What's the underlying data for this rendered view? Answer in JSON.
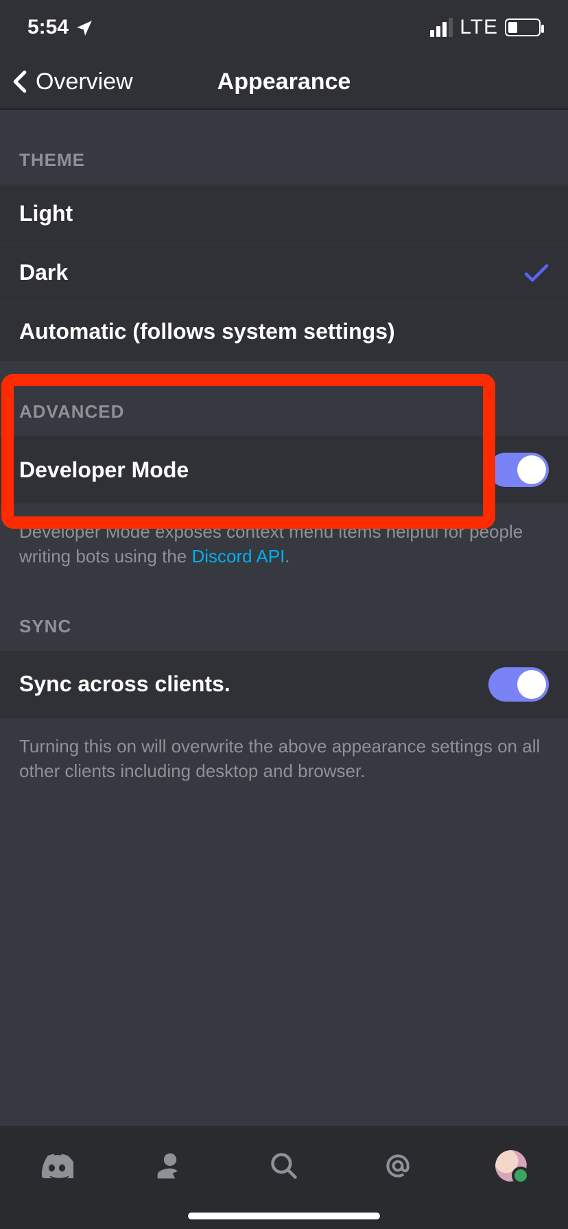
{
  "status": {
    "time": "5:54",
    "network": "LTE"
  },
  "nav": {
    "back": "Overview",
    "title": "Appearance"
  },
  "sections": {
    "theme": {
      "header": "THEME",
      "options": {
        "light": "Light",
        "dark": "Dark",
        "auto": "Automatic (follows system settings)"
      },
      "selected": "dark"
    },
    "advanced": {
      "header": "ADVANCED",
      "devmode_label": "Developer Mode",
      "devmode_on": true,
      "footer_pre": "Developer Mode exposes context menu items helpful for people writing bots using the ",
      "footer_link": "Discord API",
      "footer_post": "."
    },
    "sync": {
      "header": "SYNC",
      "sync_label": "Sync across clients.",
      "sync_on": true,
      "footer": "Turning this on will overwrite the above appearance settings on all other clients including desktop and browser."
    }
  }
}
